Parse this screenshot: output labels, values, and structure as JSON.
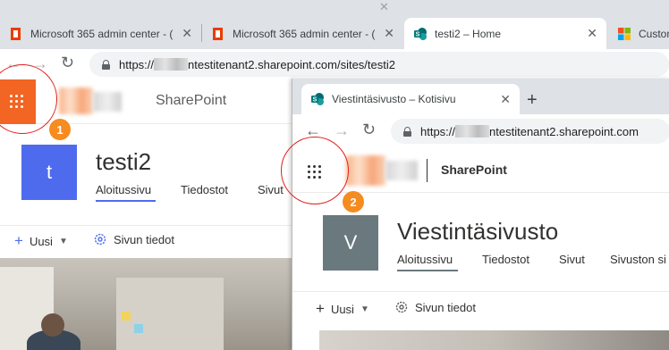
{
  "back_browser": {
    "tabs": [
      {
        "label": "Microsoft 365 admin center - (",
        "favicon": "office-icon"
      },
      {
        "label": "Microsoft 365 admin center - (",
        "favicon": "office-icon"
      },
      {
        "label": "testi2 – Home",
        "favicon": "sharepoint-icon"
      },
      {
        "label": "Custom",
        "favicon": "microsoft-icon"
      }
    ],
    "url": {
      "prefix": "https://",
      "suffix": "ntestitenant2.sharepoint.com/sites/testi2"
    }
  },
  "back_site": {
    "app_name": "SharePoint",
    "site_initial": "t",
    "site_title": "testi2",
    "nav": [
      "Aloitussivu",
      "Tiedostot",
      "Sivut"
    ],
    "commands": {
      "new_label": "Uusi",
      "details_label": "Sivun tiedot"
    }
  },
  "front_browser": {
    "tab": {
      "label": "Viestintäsivusto – Kotisivu",
      "favicon": "sharepoint-icon"
    },
    "url": {
      "prefix": "https://",
      "suffix": "ntestitenant2.sharepoint.com"
    }
  },
  "front_site": {
    "app_name": "SharePoint",
    "site_initial": "V",
    "site_title": "Viestintäsivusto",
    "nav": [
      "Aloitussivu",
      "Tiedostot",
      "Sivut",
      "Sivuston si"
    ],
    "commands": {
      "new_label": "Uusi",
      "details_label": "Sivun tiedot"
    }
  },
  "callouts": [
    "1",
    "2"
  ],
  "colors": {
    "waffle_orange": "#f26522",
    "sharepoint_teal": "#038387",
    "back_site_tile": "#4f6bed",
    "front_site_tile": "#69797e",
    "callout_ring": "#e0201b",
    "callout_badge": "#f68b1f"
  }
}
